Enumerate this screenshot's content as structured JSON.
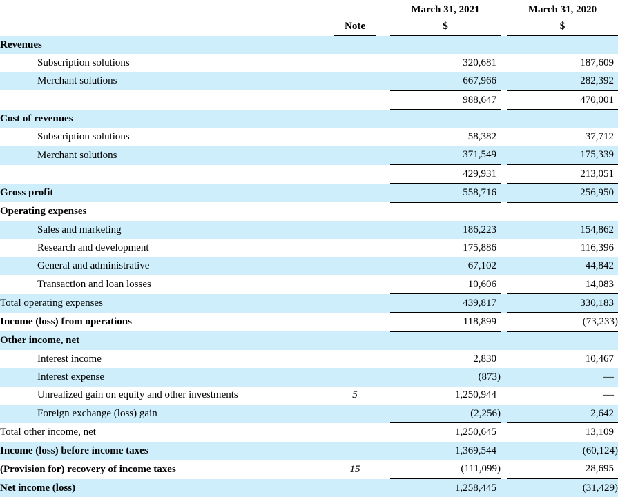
{
  "header": {
    "note_label": "Note",
    "periods": [
      "March 31, 2021",
      "March 31, 2020"
    ],
    "currency": [
      "$",
      "$"
    ]
  },
  "rows": [
    {
      "label": "Revenues",
      "style": "bold",
      "shaded": true
    },
    {
      "label": "Subscription solutions",
      "style": "indent",
      "shaded": false,
      "v1": "320,681",
      "v2": "187,609"
    },
    {
      "label": "Merchant solutions",
      "style": "indent",
      "shaded": true,
      "v1": "667,966",
      "v2": "282,392",
      "underline": true
    },
    {
      "label": "",
      "style": "indent",
      "shaded": false,
      "v1": "988,647",
      "v2": "470,001",
      "underline": true
    },
    {
      "label": "Cost of revenues",
      "style": "bold",
      "shaded": true
    },
    {
      "label": "Subscription solutions",
      "style": "indent",
      "shaded": false,
      "v1": "58,382",
      "v2": "37,712"
    },
    {
      "label": "Merchant solutions",
      "style": "indent",
      "shaded": true,
      "v1": "371,549",
      "v2": "175,339",
      "underline": true
    },
    {
      "label": "",
      "style": "indent",
      "shaded": false,
      "v1": "429,931",
      "v2": "213,051",
      "underline": true
    },
    {
      "label": "Gross profit",
      "style": "bold",
      "shaded": true,
      "v1": "558,716",
      "v2": "256,950",
      "underline": true
    },
    {
      "label": "Operating expenses",
      "style": "bold",
      "shaded": false
    },
    {
      "label": "Sales and marketing",
      "style": "indent",
      "shaded": true,
      "v1": "186,223",
      "v2": "154,862"
    },
    {
      "label": "Research and development",
      "style": "indent",
      "shaded": false,
      "v1": "175,886",
      "v2": "116,396"
    },
    {
      "label": "General and administrative",
      "style": "indent",
      "shaded": true,
      "v1": "67,102",
      "v2": "44,842"
    },
    {
      "label": "Transaction and loan losses",
      "style": "indent",
      "shaded": false,
      "v1": "10,606",
      "v2": "14,083",
      "underline": true
    },
    {
      "label": "Total operating expenses",
      "style": "plain",
      "shaded": true,
      "v1": "439,817",
      "v2": "330,183",
      "underline": true
    },
    {
      "label": "Income (loss) from operations",
      "style": "bold",
      "shaded": false,
      "v1": "118,899",
      "v2": "(73,233)",
      "underline": true
    },
    {
      "label": "Other income, net",
      "style": "bold",
      "shaded": true
    },
    {
      "label": "Interest income",
      "style": "indent",
      "shaded": false,
      "v1": "2,830",
      "v2": "10,467"
    },
    {
      "label": "Interest expense",
      "style": "indent",
      "shaded": true,
      "v1": "(873)",
      "v2": "—"
    },
    {
      "label": "Unrealized gain on equity and other investments",
      "style": "indent",
      "shaded": false,
      "note": "5",
      "v1": "1,250,944",
      "v2": "—"
    },
    {
      "label": "Foreign exchange (loss) gain",
      "style": "indent",
      "shaded": true,
      "v1": "(2,256)",
      "v2": "2,642",
      "underline": true
    },
    {
      "label": "Total other income, net",
      "style": "plain",
      "shaded": false,
      "v1": "1,250,645",
      "v2": "13,109",
      "underline": true
    },
    {
      "label": "Income (loss) before income taxes",
      "style": "bold",
      "shaded": true,
      "v1": "1,369,544",
      "v2": "(60,124)"
    },
    {
      "label": "(Provision for) recovery of income taxes",
      "style": "bold",
      "shaded": false,
      "note": "15",
      "v1": "(111,099)",
      "v2": "28,695",
      "underline": true
    },
    {
      "label": "Net income (loss)",
      "style": "bold",
      "shaded": true,
      "v1": "1,258,445",
      "v2": "(31,429)"
    }
  ]
}
